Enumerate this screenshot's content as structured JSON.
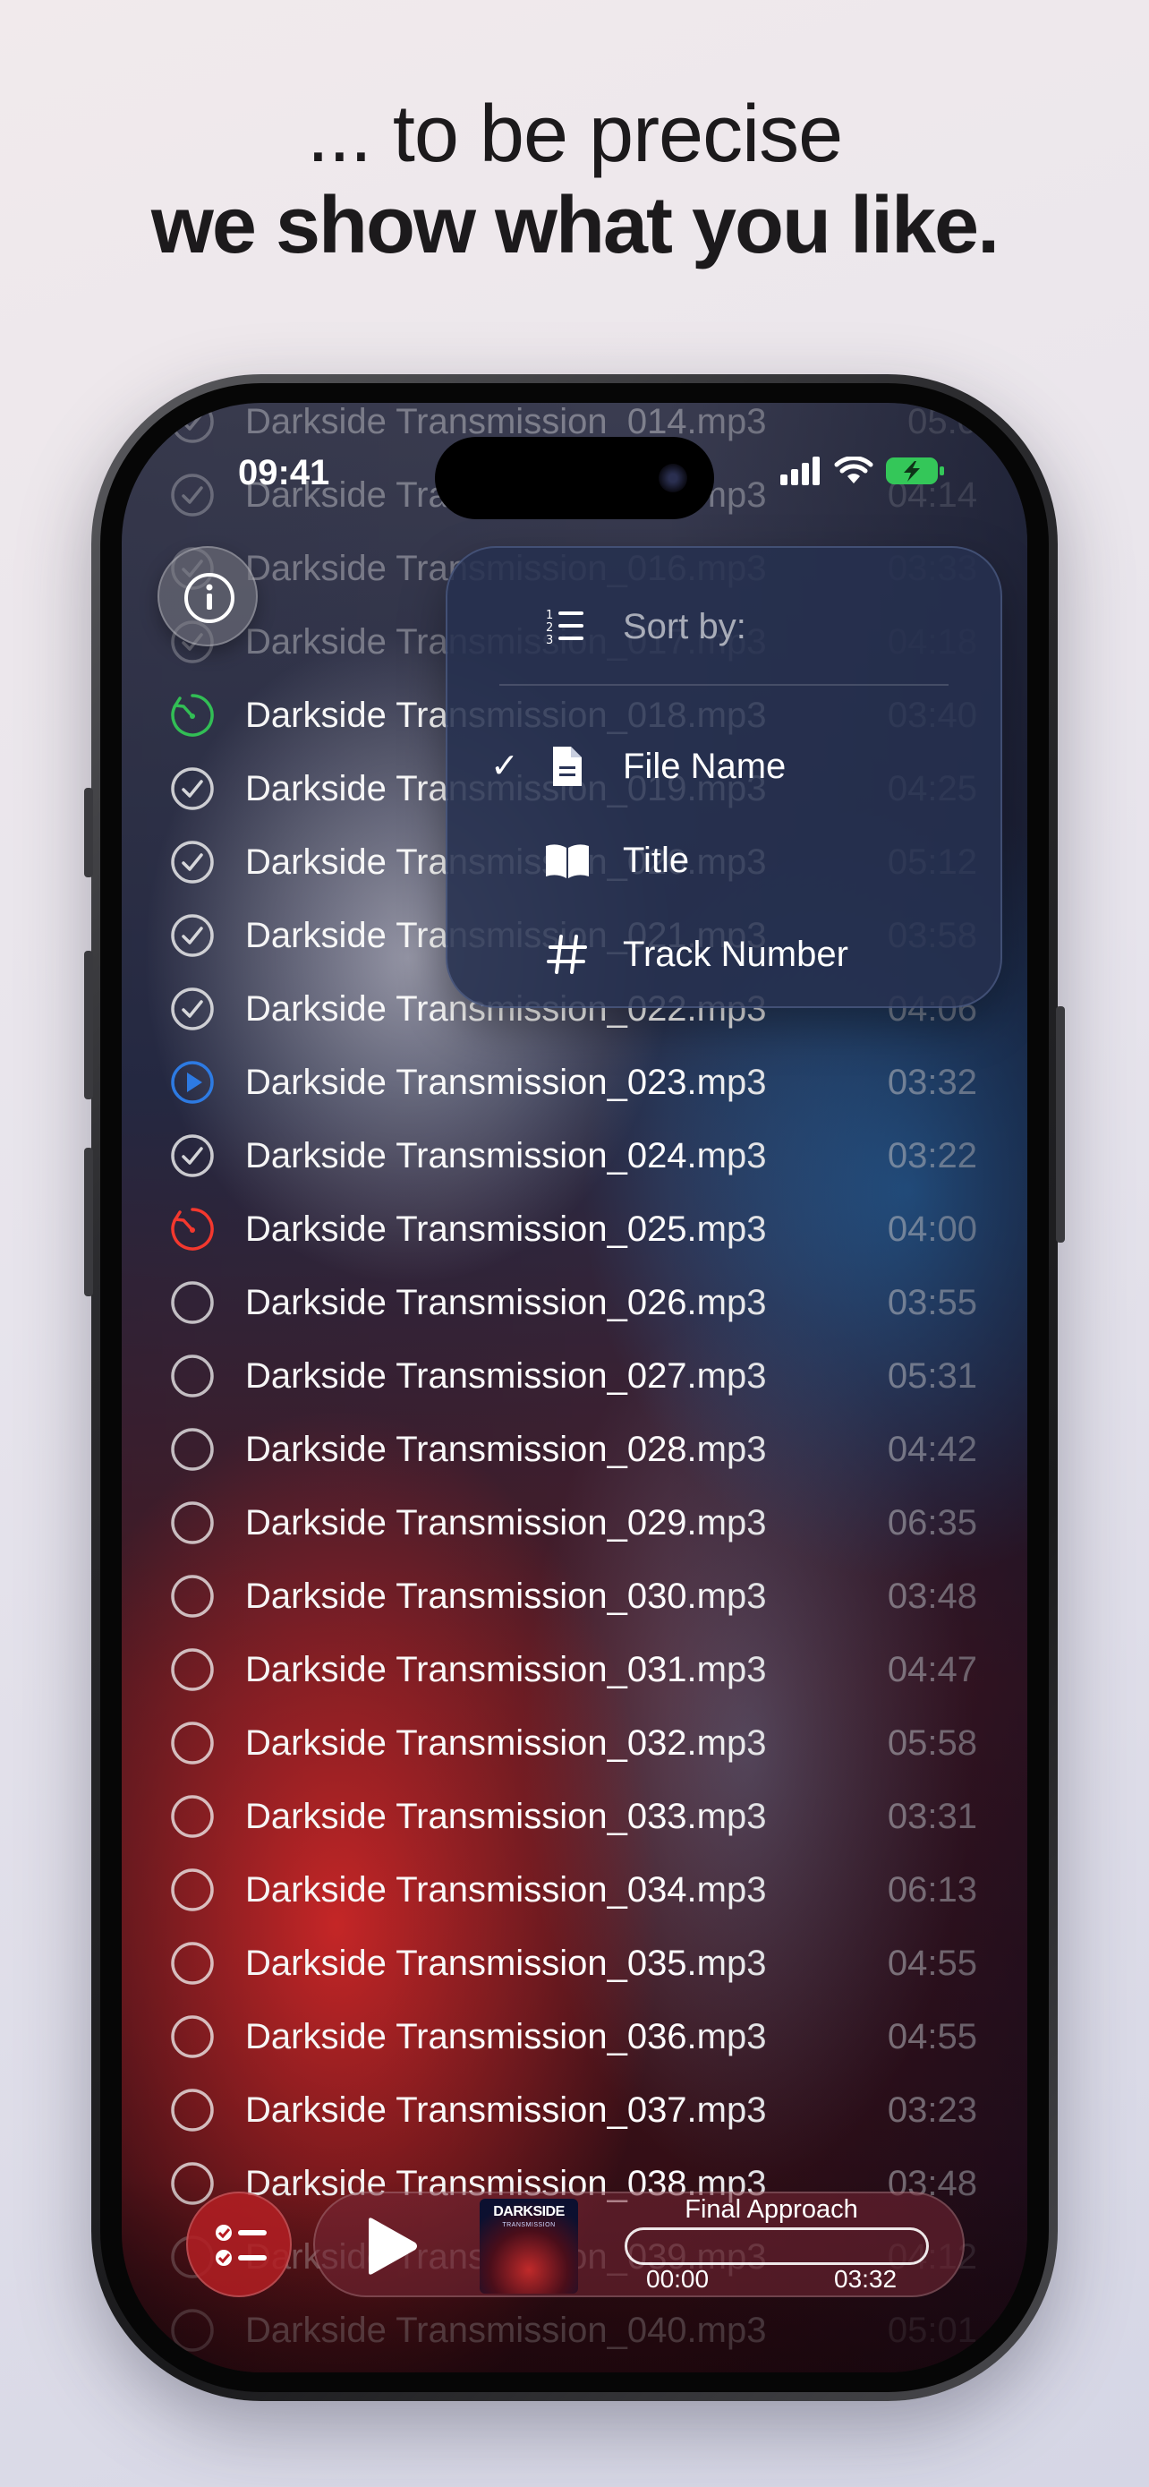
{
  "headline": {
    "line1": "... to be precise",
    "line2": "we show what you like."
  },
  "status_bar": {
    "time": "09:41",
    "icons": [
      "cellular-signal-icon",
      "wifi-icon",
      "battery-charging-icon"
    ]
  },
  "colors": {
    "accent_green": "#34c759",
    "accent_blue": "#2f80ed",
    "accent_red": "#ff3b30"
  },
  "tracks": [
    {
      "name": "Darkside Transmission_014.mp3",
      "duration": "05:0",
      "status": "done",
      "faded": true
    },
    {
      "name": "Darkside Transmission_015.mp3",
      "duration": "04:14",
      "status": "done",
      "faded": true
    },
    {
      "name": "Darkside Transmission_016.mp3",
      "duration": "03:33",
      "status": "done",
      "faded": true
    },
    {
      "name": "Darkside Transmission_017.mp3",
      "duration": "04:18",
      "status": "done",
      "faded": true
    },
    {
      "name": "Darkside Transmission_018.mp3",
      "duration": "03:40",
      "status": "in-progress-green",
      "faded": false
    },
    {
      "name": "Darkside Transmission_019.mp3",
      "duration": "04:25",
      "status": "done",
      "faded": false
    },
    {
      "name": "Darkside Transmission_020.mp3",
      "duration": "05:12",
      "status": "done",
      "faded": false
    },
    {
      "name": "Darkside Transmission_021.mp3",
      "duration": "03:58",
      "status": "done",
      "faded": false
    },
    {
      "name": "Darkside Transmission_022.mp3",
      "duration": "04:06",
      "status": "done",
      "faded": false
    },
    {
      "name": "Darkside Transmission_023.mp3",
      "duration": "03:32",
      "status": "playing",
      "faded": false
    },
    {
      "name": "Darkside Transmission_024.mp3",
      "duration": "03:22",
      "status": "done",
      "faded": false
    },
    {
      "name": "Darkside Transmission_025.mp3",
      "duration": "04:00",
      "status": "in-progress-red",
      "faded": false
    },
    {
      "name": "Darkside Transmission_026.mp3",
      "duration": "03:55",
      "status": "new",
      "faded": false
    },
    {
      "name": "Darkside Transmission_027.mp3",
      "duration": "05:31",
      "status": "new",
      "faded": false
    },
    {
      "name": "Darkside Transmission_028.mp3",
      "duration": "04:42",
      "status": "new",
      "faded": false
    },
    {
      "name": "Darkside Transmission_029.mp3",
      "duration": "06:35",
      "status": "new",
      "faded": false
    },
    {
      "name": "Darkside Transmission_030.mp3",
      "duration": "03:48",
      "status": "new",
      "faded": false
    },
    {
      "name": "Darkside Transmission_031.mp3",
      "duration": "04:47",
      "status": "new",
      "faded": false
    },
    {
      "name": "Darkside Transmission_032.mp3",
      "duration": "05:58",
      "status": "new",
      "faded": false
    },
    {
      "name": "Darkside Transmission_033.mp3",
      "duration": "03:31",
      "status": "new",
      "faded": false
    },
    {
      "name": "Darkside Transmission_034.mp3",
      "duration": "06:13",
      "status": "new",
      "faded": false
    },
    {
      "name": "Darkside Transmission_035.mp3",
      "duration": "04:55",
      "status": "new",
      "faded": false
    },
    {
      "name": "Darkside Transmission_036.mp3",
      "duration": "04:55",
      "status": "new",
      "faded": false
    },
    {
      "name": "Darkside Transmission_037.mp3",
      "duration": "03:23",
      "status": "new",
      "faded": false
    },
    {
      "name": "Darkside Transmission_038.mp3",
      "duration": "03:48",
      "status": "new",
      "faded": false
    },
    {
      "name": "Darkside Transmission_039.mp3",
      "duration": "04:12",
      "status": "new",
      "faded": true
    },
    {
      "name": "Darkside Transmission_040.mp3",
      "duration": "05:01",
      "status": "new",
      "faded": true
    }
  ],
  "sort_menu": {
    "header": "Sort by:",
    "options": [
      {
        "label": "File Name",
        "icon": "document-icon",
        "selected": true
      },
      {
        "label": "Title",
        "icon": "book-icon",
        "selected": false
      },
      {
        "label": "Track Number",
        "icon": "hash-icon",
        "selected": false
      }
    ]
  },
  "player": {
    "title": "Final Approach",
    "elapsed": "00:00",
    "total": "03:32",
    "progress": 0,
    "artwork_title": "DARKSIDE",
    "artwork_subtitle": "TRANSMISSION"
  }
}
